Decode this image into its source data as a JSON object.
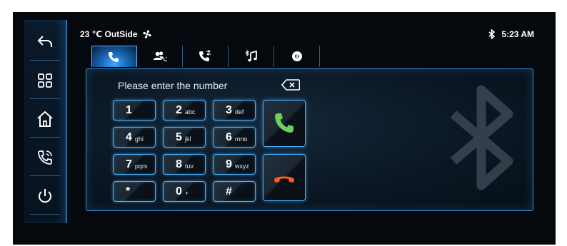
{
  "status": {
    "temperature": "23 ℃ OutSide",
    "time": "5:23 AM"
  },
  "tabs": [
    {
      "name": "dialpad",
      "active": true
    },
    {
      "name": "contacts",
      "active": false
    },
    {
      "name": "recent-calls",
      "active": false
    },
    {
      "name": "bluetooth-music",
      "active": false
    },
    {
      "name": "bluetooth-settings",
      "active": false
    }
  ],
  "dialer": {
    "prompt": "Please enter the number",
    "keys": [
      {
        "main": "1",
        "sub": ""
      },
      {
        "main": "2",
        "sub": "abc"
      },
      {
        "main": "3",
        "sub": "def"
      },
      {
        "main": "4",
        "sub": "ghi"
      },
      {
        "main": "5",
        "sub": "jkl"
      },
      {
        "main": "6",
        "sub": "mno"
      },
      {
        "main": "7",
        "sub": "pqrs"
      },
      {
        "main": "8",
        "sub": "tuv"
      },
      {
        "main": "9",
        "sub": "wxyz"
      },
      {
        "main": "*",
        "sub": ""
      },
      {
        "main": "0",
        "sub": "+"
      },
      {
        "main": "#",
        "sub": ""
      }
    ]
  },
  "colors": {
    "accent": "#3aa0ff",
    "call_green": "#6fcf5a",
    "hangup_orange": "#ff5a1f"
  },
  "icons": {
    "rail": [
      "back-icon",
      "apps-grid-icon",
      "home-icon",
      "phone-icon",
      "power-icon"
    ],
    "status": [
      "fan-icon",
      "bluetooth-icon"
    ]
  }
}
